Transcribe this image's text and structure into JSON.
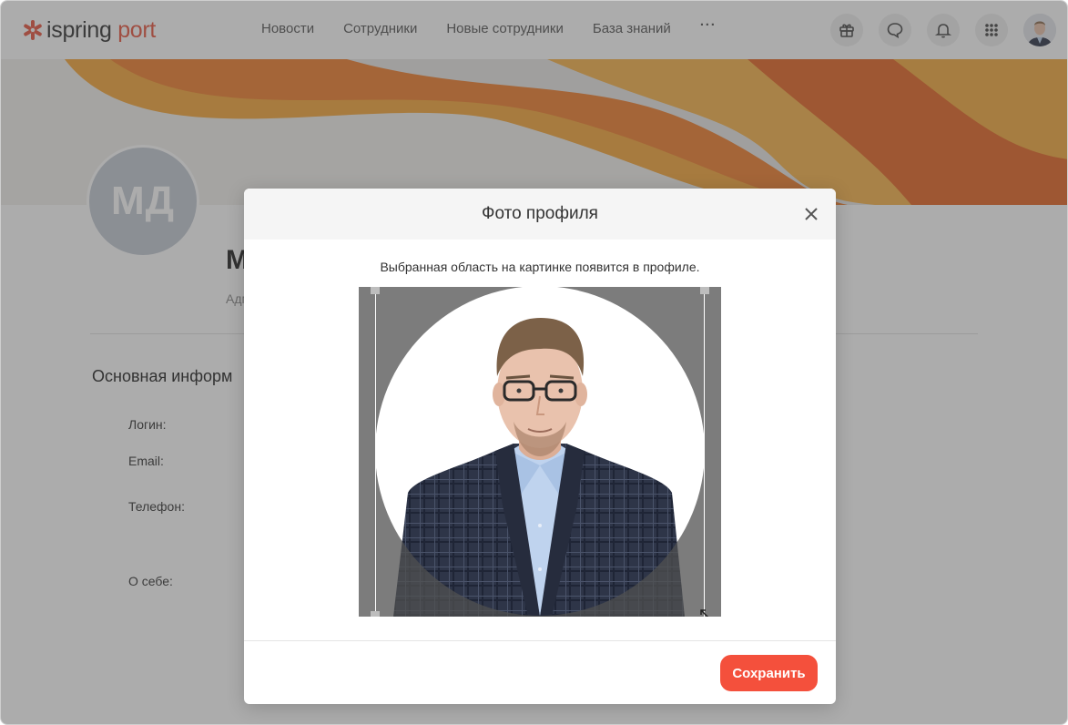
{
  "header": {
    "logo_part1": "ispring",
    "logo_part2": "port",
    "nav": [
      "Новости",
      "Сотрудники",
      "Новые сотрудники",
      "База знаний"
    ],
    "more_label": "···",
    "icons": [
      "gift-icon",
      "chat-icon",
      "bell-icon",
      "apps-grid-icon",
      "user-avatar"
    ]
  },
  "profile": {
    "initials": "МД",
    "name_visible": "М",
    "role_visible": "Адм",
    "section_title": "Основная информ",
    "fields": [
      "Логин:",
      "Email:",
      "Телефон:",
      "О себе:"
    ]
  },
  "modal": {
    "title": "Фото профиля",
    "hint": "Выбранная область на картинке появится в профиле.",
    "save_label": "Сохранить",
    "icons": [
      "close-icon",
      "resize-diagonal-icon"
    ]
  },
  "colors": {
    "brand": "#e8553e",
    "save_button": "#f4503c",
    "overlay": "#464648"
  }
}
